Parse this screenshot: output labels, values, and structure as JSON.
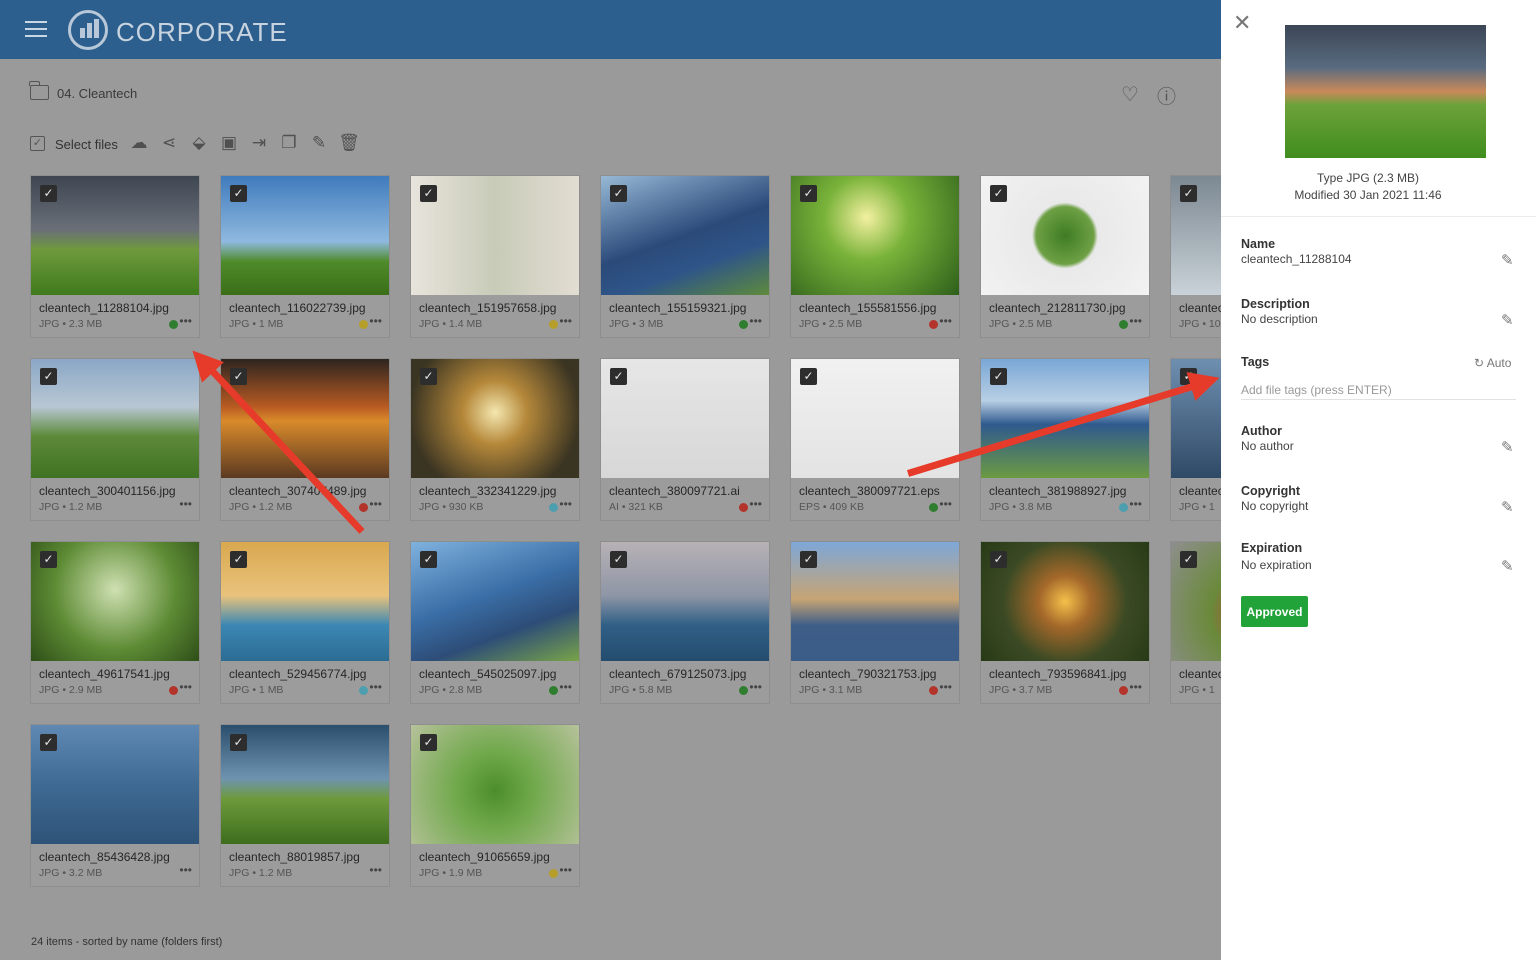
{
  "header": {
    "brand": "CORPORATE"
  },
  "breadcrumb": {
    "folder": "04. Cleantech"
  },
  "toolbar": {
    "select_label": "Select files"
  },
  "files": [
    {
      "name": "cleantech_11288104.jpg",
      "meta": "JPG • 2.3 MB",
      "status": "green"
    },
    {
      "name": "cleantech_116022739.jpg",
      "meta": "JPG • 1 MB",
      "status": "yellow"
    },
    {
      "name": "cleantech_151957658.jpg",
      "meta": "JPG • 1.4 MB",
      "status": "yellow"
    },
    {
      "name": "cleantech_155159321.jpg",
      "meta": "JPG • 3 MB",
      "status": "green"
    },
    {
      "name": "cleantech_155581556.jpg",
      "meta": "JPG • 2.5 MB",
      "status": "red"
    },
    {
      "name": "cleantech_212811730.jpg",
      "meta": "JPG • 2.5 MB",
      "status": "green"
    },
    {
      "name": "cleantec",
      "meta": "JPG • 10",
      "status": ""
    },
    {
      "name": "cleantech_300401156.jpg",
      "meta": "JPG • 1.2 MB",
      "status": ""
    },
    {
      "name": "cleantech_307407489.jpg",
      "meta": "JPG • 1.2 MB",
      "status": "red"
    },
    {
      "name": "cleantech_332341229.jpg",
      "meta": "JPG • 930 KB",
      "status": "teal"
    },
    {
      "name": "cleantech_380097721.ai",
      "meta": "AI • 321 KB",
      "status": "red"
    },
    {
      "name": "cleantech_380097721.eps",
      "meta": "EPS • 409 KB",
      "status": "green"
    },
    {
      "name": "cleantech_381988927.jpg",
      "meta": "JPG • 3.8 MB",
      "status": "teal"
    },
    {
      "name": "cleantec",
      "meta": "JPG • 1",
      "status": ""
    },
    {
      "name": "cleantech_49617541.jpg",
      "meta": "JPG • 2.9 MB",
      "status": "red"
    },
    {
      "name": "cleantech_529456774.jpg",
      "meta": "JPG • 1 MB",
      "status": "teal"
    },
    {
      "name": "cleantech_545025097.jpg",
      "meta": "JPG • 2.8 MB",
      "status": "green"
    },
    {
      "name": "cleantech_679125073.jpg",
      "meta": "JPG • 5.8 MB",
      "status": "green"
    },
    {
      "name": "cleantech_790321753.jpg",
      "meta": "JPG • 3.1 MB",
      "status": "red"
    },
    {
      "name": "cleantech_793596841.jpg",
      "meta": "JPG • 3.7 MB",
      "status": "red"
    },
    {
      "name": "cleantec",
      "meta": "JPG • 1",
      "status": ""
    },
    {
      "name": "cleantech_85436428.jpg",
      "meta": "JPG • 3.2 MB",
      "status": ""
    },
    {
      "name": "cleantech_88019857.jpg",
      "meta": "JPG • 1.2 MB",
      "status": ""
    },
    {
      "name": "cleantech_91065659.jpg",
      "meta": "JPG • 1.9 MB",
      "status": "yellow"
    }
  ],
  "status_colors": {
    "green": "#2f7d2f",
    "yellow": "#b59e2a",
    "red": "#b3342a",
    "teal": "#4d9fb0"
  },
  "footer": {
    "text": "24 items - sorted by name (folders first)"
  },
  "panel": {
    "type": "Type JPG (2.3 MB)",
    "modified": "Modified 30 Jan 2021 11:46",
    "name_label": "Name",
    "name_value": "cleantech_11288104",
    "description_label": "Description",
    "description_value": "No description",
    "tags_label": "Tags",
    "auto_label": "Auto",
    "tags_placeholder": "Add file tags (press ENTER)",
    "author_label": "Author",
    "author_value": "No author",
    "copyright_label": "Copyright",
    "copyright_value": "No copyright",
    "expiration_label": "Expiration",
    "expiration_value": "No expiration",
    "approved_label": "Approved"
  }
}
